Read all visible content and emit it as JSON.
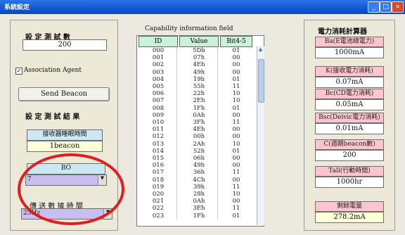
{
  "window": {
    "title": "系統設定"
  },
  "left": {
    "header_label": "設 定 測 試 數",
    "count_value": "200",
    "checkbox_label": "Association Agent",
    "send_button": "Send Beacon",
    "section_label": "設 定 測 試 結 果",
    "timer_label": "接收器睡眠時間",
    "timer_value": "1beacon",
    "bo_label": "BO",
    "bo_value": "7",
    "period_label": "傳 送 數 據 時 間",
    "period_value": "25Hz"
  },
  "middle": {
    "caption": "Capability information field",
    "headers": [
      "ID",
      "Value",
      "Bit4-5"
    ],
    "rows": [
      [
        "000",
        "5Dh",
        "01"
      ],
      [
        "001",
        "07h",
        "00"
      ],
      [
        "002",
        "4Eh",
        "00"
      ],
      [
        "003",
        "49h",
        "00"
      ],
      [
        "004",
        "19h",
        "01"
      ],
      [
        "005",
        "55h",
        "11"
      ],
      [
        "006",
        "22h",
        "10"
      ],
      [
        "007",
        "2Eh",
        "10"
      ],
      [
        "008",
        "1Fh",
        "01"
      ],
      [
        "009",
        "0Ah",
        "00"
      ],
      [
        "010",
        "3Fh",
        "11"
      ],
      [
        "011",
        "4Eh",
        "00"
      ],
      [
        "012",
        "00h",
        "00"
      ],
      [
        "013",
        "2Ah",
        "10"
      ],
      [
        "014",
        "52h",
        "01"
      ],
      [
        "015",
        "06h",
        "00"
      ],
      [
        "016",
        "49h",
        "00"
      ],
      [
        "017",
        "36h",
        "11"
      ],
      [
        "018",
        "4Ch",
        "00"
      ],
      [
        "019",
        "39h",
        "11"
      ],
      [
        "020",
        "28h",
        "10"
      ],
      [
        "021",
        "0Ah",
        "00"
      ],
      [
        "022",
        "3Eh",
        "11"
      ],
      [
        "023",
        "1Fh",
        "01"
      ]
    ]
  },
  "right": {
    "caption": "電力消耗計算器",
    "items": [
      {
        "label": "Ba(E電池總電力)",
        "value": "1000mA"
      },
      {
        "label": "K(接收電力消耗)",
        "value": "0.07mA"
      },
      {
        "label": "Bc(CD電力消耗)",
        "value": "0.05mA"
      },
      {
        "label": "Bsc(Deivic電力消耗)",
        "value": "0.01mA"
      },
      {
        "label": "C(週期beacon數)",
        "value": "200"
      },
      {
        "label": "Tall(行動時間)",
        "value": "1000hr"
      }
    ],
    "total_label": "剩餘電量",
    "total_value": "278.2mA"
  }
}
